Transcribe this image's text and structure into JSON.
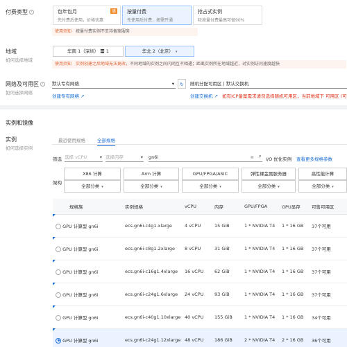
{
  "billing": {
    "label": "付费类型",
    "options": [
      {
        "title": "包年包月",
        "desc": "先付费后使用，价格优惠",
        "badge": "惠"
      },
      {
        "title": "按量付费",
        "desc": "先使用后付费，按需开通"
      },
      {
        "title": "抢占式实例",
        "desc": "较按量付费最高可省90%"
      }
    ],
    "notice_tag": "使用须知",
    "notice_text": "按量付费实例不支持备案服务"
  },
  "region": {
    "label": "地域",
    "help": "如何选择地域",
    "options": [
      {
        "text": "华南 1（深圳）",
        "flag": "〓 1"
      },
      {
        "text": "华北 2（北京）",
        "chev": "▾"
      }
    ],
    "notice_tag": "使用须知",
    "notice_warn": "实例创建之后地域无法更改，",
    "notice_text": "不同地域的实例之间内网互不相通；距离实例所在地域越近，对实例访问速度越快"
  },
  "network": {
    "label": "网络及可用区",
    "help": "如何选择网络",
    "vpc_value": "默认专有网络",
    "vpc_chev": "▾",
    "refresh_icon": "↻",
    "zone_value": "随机分配可用区 | 默认交换机",
    "vpc_link": "创建专有网络",
    "switch_link": "创建交换机",
    "zone_warn": "如有ICP备案需求请勿选择随机可用区，当前地域下 可用区 (可用区"
  },
  "instance": {
    "section_title": "实例和镜像",
    "label": "实例",
    "help": "如何选择实例",
    "tabs": [
      "最近使用规格",
      "全部规格"
    ],
    "filter_label": "筛选",
    "filter_vcpu": "选择 vCPU",
    "filter_mem": "选择内存",
    "search_value": "gn6i",
    "io_label": "I/O 优化实例",
    "more_link": "查看更多规格参数",
    "arch_label": "架构",
    "arch_headers": [
      "X86 计算",
      "Arm 计算",
      "GPU/FPGA/ASIC",
      "弹性裸金属服务器",
      "高性能计算"
    ],
    "arch_selects": [
      "全部分类",
      "全部分类",
      "全部分类",
      "全部分类",
      "全部分类"
    ],
    "table": {
      "headers": [
        "规格族",
        "实例规格",
        "vCPU",
        "内存",
        "GPU/FPGA",
        "GPU显存",
        "可售可用区"
      ],
      "rows": [
        [
          "GPU 计算型 gn6i",
          "ecs.gn6i-c4g1.xlarge",
          "4 vCPU",
          "15 GiB",
          "1 * NVIDIA T4",
          "1 * 16 GB",
          "37个可用"
        ],
        [
          "GPU 计算型 gn6i",
          "ecs.gn6i-c8g1.2xlarge",
          "8 vCPU",
          "31 GiB",
          "1 * NVIDIA T4",
          "1 * 16 GB",
          "37个可用"
        ],
        [
          "GPU 计算型 gn6i",
          "ecs.gn6i-c16g1.4xlarge",
          "16 vCPU",
          "62 GiB",
          "1 * NVIDIA T4",
          "1 * 16 GB",
          "37个可用"
        ],
        [
          "GPU 计算型 gn6i",
          "ecs.gn6i-c24g1.6xlarge",
          "24 vCPU",
          "93 GiB",
          "1 * NVIDIA T4",
          "1 * 16 GB",
          "37个可用"
        ],
        [
          "GPU 计算型 gn6i",
          "ecs.gn6i-c40g1.10xlarge",
          "40 vCPU",
          "155 GiB",
          "1 * NVIDIA T4",
          "1 * 16 GB",
          "34个可用"
        ],
        [
          "GPU 计算型 gn6i",
          "ecs.gn6i-c24g1.12xlarge",
          "48 vCPU",
          "186 GiB",
          "2 * NVIDIA T4",
          "2 * 16 GB",
          "36个可用"
        ]
      ],
      "selected_row": 5
    }
  },
  "colors": {
    "accent": "#1a6fd6",
    "warn": "#e06a3b",
    "selected_bg": "#eaf3ff"
  }
}
